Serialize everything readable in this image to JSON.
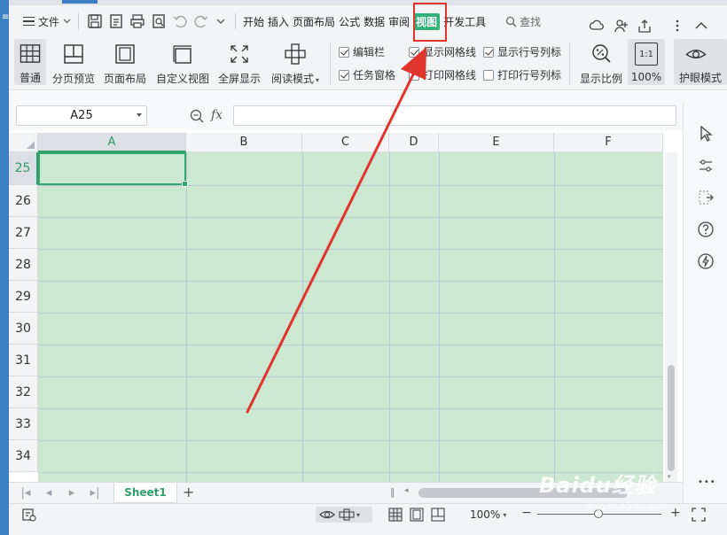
{
  "menubar": {
    "file_label": "文件",
    "tabs": [
      "开始",
      "插入",
      "页面布局",
      "公式",
      "数据",
      "审阅",
      "视图",
      "开发工具"
    ],
    "active_tab": "视图",
    "search_label": "查找"
  },
  "ribbon": {
    "buttons": [
      "普通",
      "分页预览",
      "页面布局",
      "自定义视图",
      "全屏显示",
      "阅读模式",
      "显示比例",
      "100%",
      "护眼模式"
    ],
    "reading_mode_has_dropdown": true,
    "checkboxes": [
      {
        "label": "编辑栏",
        "checked": true
      },
      {
        "label": "任务窗格",
        "checked": true
      },
      {
        "label": "显示网格线",
        "checked": true
      },
      {
        "label": "打印网格线",
        "checked": false
      },
      {
        "label": "显示行号列标",
        "checked": true
      },
      {
        "label": "打印行号列标",
        "checked": false
      }
    ],
    "zoom_box": "1:1"
  },
  "formula_bar": {
    "cell_ref": "A25",
    "fx_label": "fx",
    "formula_value": ""
  },
  "sheet": {
    "columns": [
      "A",
      "B",
      "C",
      "D",
      "E",
      "F"
    ],
    "rows": [
      "25",
      "26",
      "27",
      "28",
      "29",
      "30",
      "31",
      "32",
      "33",
      "34"
    ],
    "selected_column": "A",
    "selected_row": "25",
    "cell_fill": "#cde8d1",
    "gridline_color": "#b8c9dc",
    "accent": "#2f9e6a"
  },
  "sheet_tabs": {
    "active": "Sheet1",
    "add": "+"
  },
  "status": {
    "zoom": "100%",
    "minus": "−",
    "plus": "+"
  },
  "side_panel": {
    "more": "•••"
  },
  "overlay": {
    "highlight_color": "#e0342d",
    "watermark": "Baidu经验",
    "watermark_sub": "jingyan.baidu.com"
  }
}
